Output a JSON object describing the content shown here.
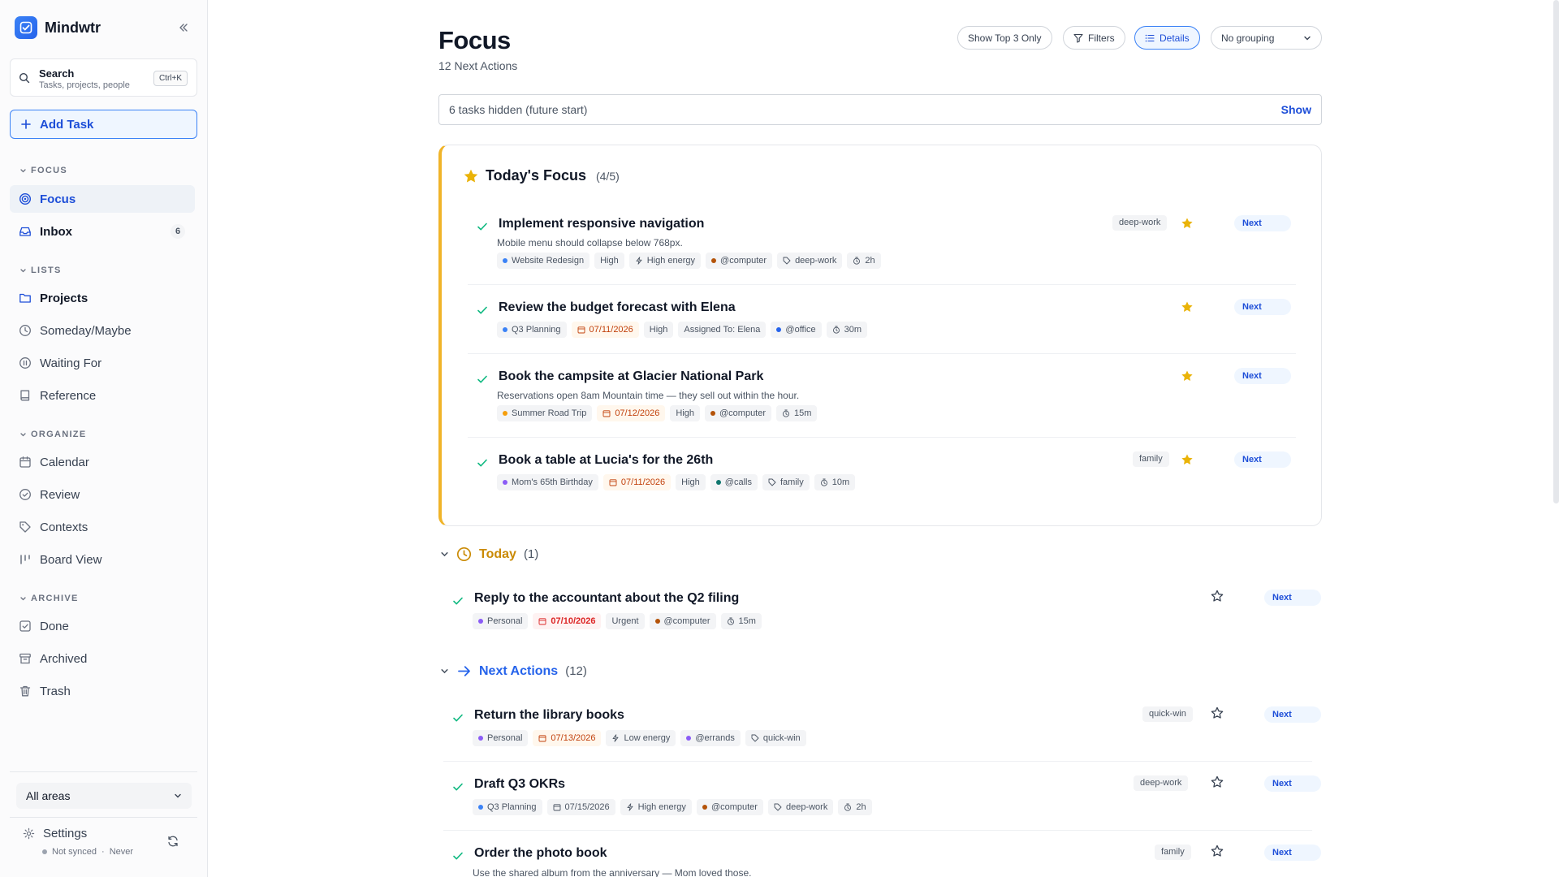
{
  "app": {
    "name": "Mindwtr"
  },
  "sidebar": {
    "search": {
      "title": "Search",
      "subtitle": "Tasks, projects, people",
      "shortcut": "Ctrl+K"
    },
    "add_task": "Add Task",
    "sections": {
      "focus": "FOCUS",
      "lists": "LISTS",
      "organize": "ORGANIZE",
      "archive": "ARCHIVE"
    },
    "focus_items": [
      {
        "label": "Focus",
        "icon": "target-icon"
      },
      {
        "label": "Inbox",
        "icon": "inbox-icon",
        "count": "6"
      }
    ],
    "list_items": [
      {
        "label": "Projects",
        "icon": "folder-icon"
      },
      {
        "label": "Someday/Maybe",
        "icon": "clock-icon"
      },
      {
        "label": "Waiting For",
        "icon": "pause-icon"
      },
      {
        "label": "Reference",
        "icon": "book-icon"
      }
    ],
    "organize_items": [
      {
        "label": "Calendar",
        "icon": "calendar-icon"
      },
      {
        "label": "Review",
        "icon": "check-circle-icon"
      },
      {
        "label": "Contexts",
        "icon": "tag-icon"
      },
      {
        "label": "Board View",
        "icon": "columns-icon"
      }
    ],
    "archive_items": [
      {
        "label": "Done",
        "icon": "check-square-icon"
      },
      {
        "label": "Archived",
        "icon": "archive-icon"
      },
      {
        "label": "Trash",
        "icon": "trash-icon"
      }
    ],
    "area_select": "All areas",
    "settings": "Settings",
    "sync_status": "Not synced",
    "sync_last": "Never"
  },
  "header": {
    "title": "Focus",
    "subtitle": "12 Next Actions",
    "buttons": {
      "top3": "Show Top 3 Only",
      "filters": "Filters",
      "details": "Details"
    },
    "grouping": "No grouping"
  },
  "hidden_notice": {
    "text": "6 tasks hidden (future start)",
    "action": "Show"
  },
  "colors": {
    "accent": "#2563eb",
    "focus_border": "#f0b429",
    "star": "#eab308",
    "today": "#ca8a04"
  },
  "todays_focus": {
    "title": "Today's Focus",
    "count": "(4/5)",
    "tasks": [
      {
        "title": "Implement responsive navigation",
        "description": "Mobile menu should collapse below 768px.",
        "tag_right": "deep-work",
        "status": "Next",
        "chips": {
          "project": "Website Redesign",
          "priority": "High",
          "energy": "High energy",
          "context": "@computer",
          "tag": "deep-work",
          "time": "2h"
        }
      },
      {
        "title": "Review the budget forecast with Elena",
        "status": "Next",
        "chips": {
          "project": "Q3 Planning",
          "date": "07/11/2026",
          "priority": "High",
          "assigned": "Assigned To: Elena",
          "context": "@office",
          "time": "30m"
        }
      },
      {
        "title": "Book the campsite at Glacier National Park",
        "description": "Reservations open 8am Mountain time — they sell out within the hour.",
        "status": "Next",
        "chips": {
          "project": "Summer Road Trip",
          "date": "07/12/2026",
          "priority": "High",
          "context": "@computer",
          "time": "15m"
        }
      },
      {
        "title": "Book a table at Lucia's for the 26th",
        "tag_right": "family",
        "status": "Next",
        "chips": {
          "project": "Mom's 65th Birthday",
          "date": "07/11/2026",
          "priority": "High",
          "context": "@calls",
          "tag": "family",
          "time": "10m"
        }
      }
    ]
  },
  "today_group": {
    "title": "Today",
    "count": "(1)",
    "tasks": [
      {
        "title": "Reply to the accountant about the Q2 filing",
        "status": "Next",
        "chips": {
          "project": "Personal",
          "date": "07/10/2026",
          "priority": "Urgent",
          "context": "@computer",
          "time": "15m"
        }
      }
    ]
  },
  "next_group": {
    "title": "Next Actions",
    "count": "(12)",
    "tasks": [
      {
        "title": "Return the library books",
        "tag_right": "quick-win",
        "status": "Next",
        "chips": {
          "project": "Personal",
          "date": "07/13/2026",
          "energy": "Low energy",
          "context": "@errands",
          "tag": "quick-win"
        }
      },
      {
        "title": "Draft Q3 OKRs",
        "tag_right": "deep-work",
        "status": "Next",
        "chips": {
          "project": "Q3 Planning",
          "date": "07/15/2026",
          "energy": "High energy",
          "context": "@computer",
          "tag": "deep-work",
          "time": "2h"
        }
      },
      {
        "title": "Order the photo book",
        "description": "Use the shared album from the anniversary — Mom loved those.",
        "tag_right": "family",
        "status": "Next"
      }
    ]
  }
}
